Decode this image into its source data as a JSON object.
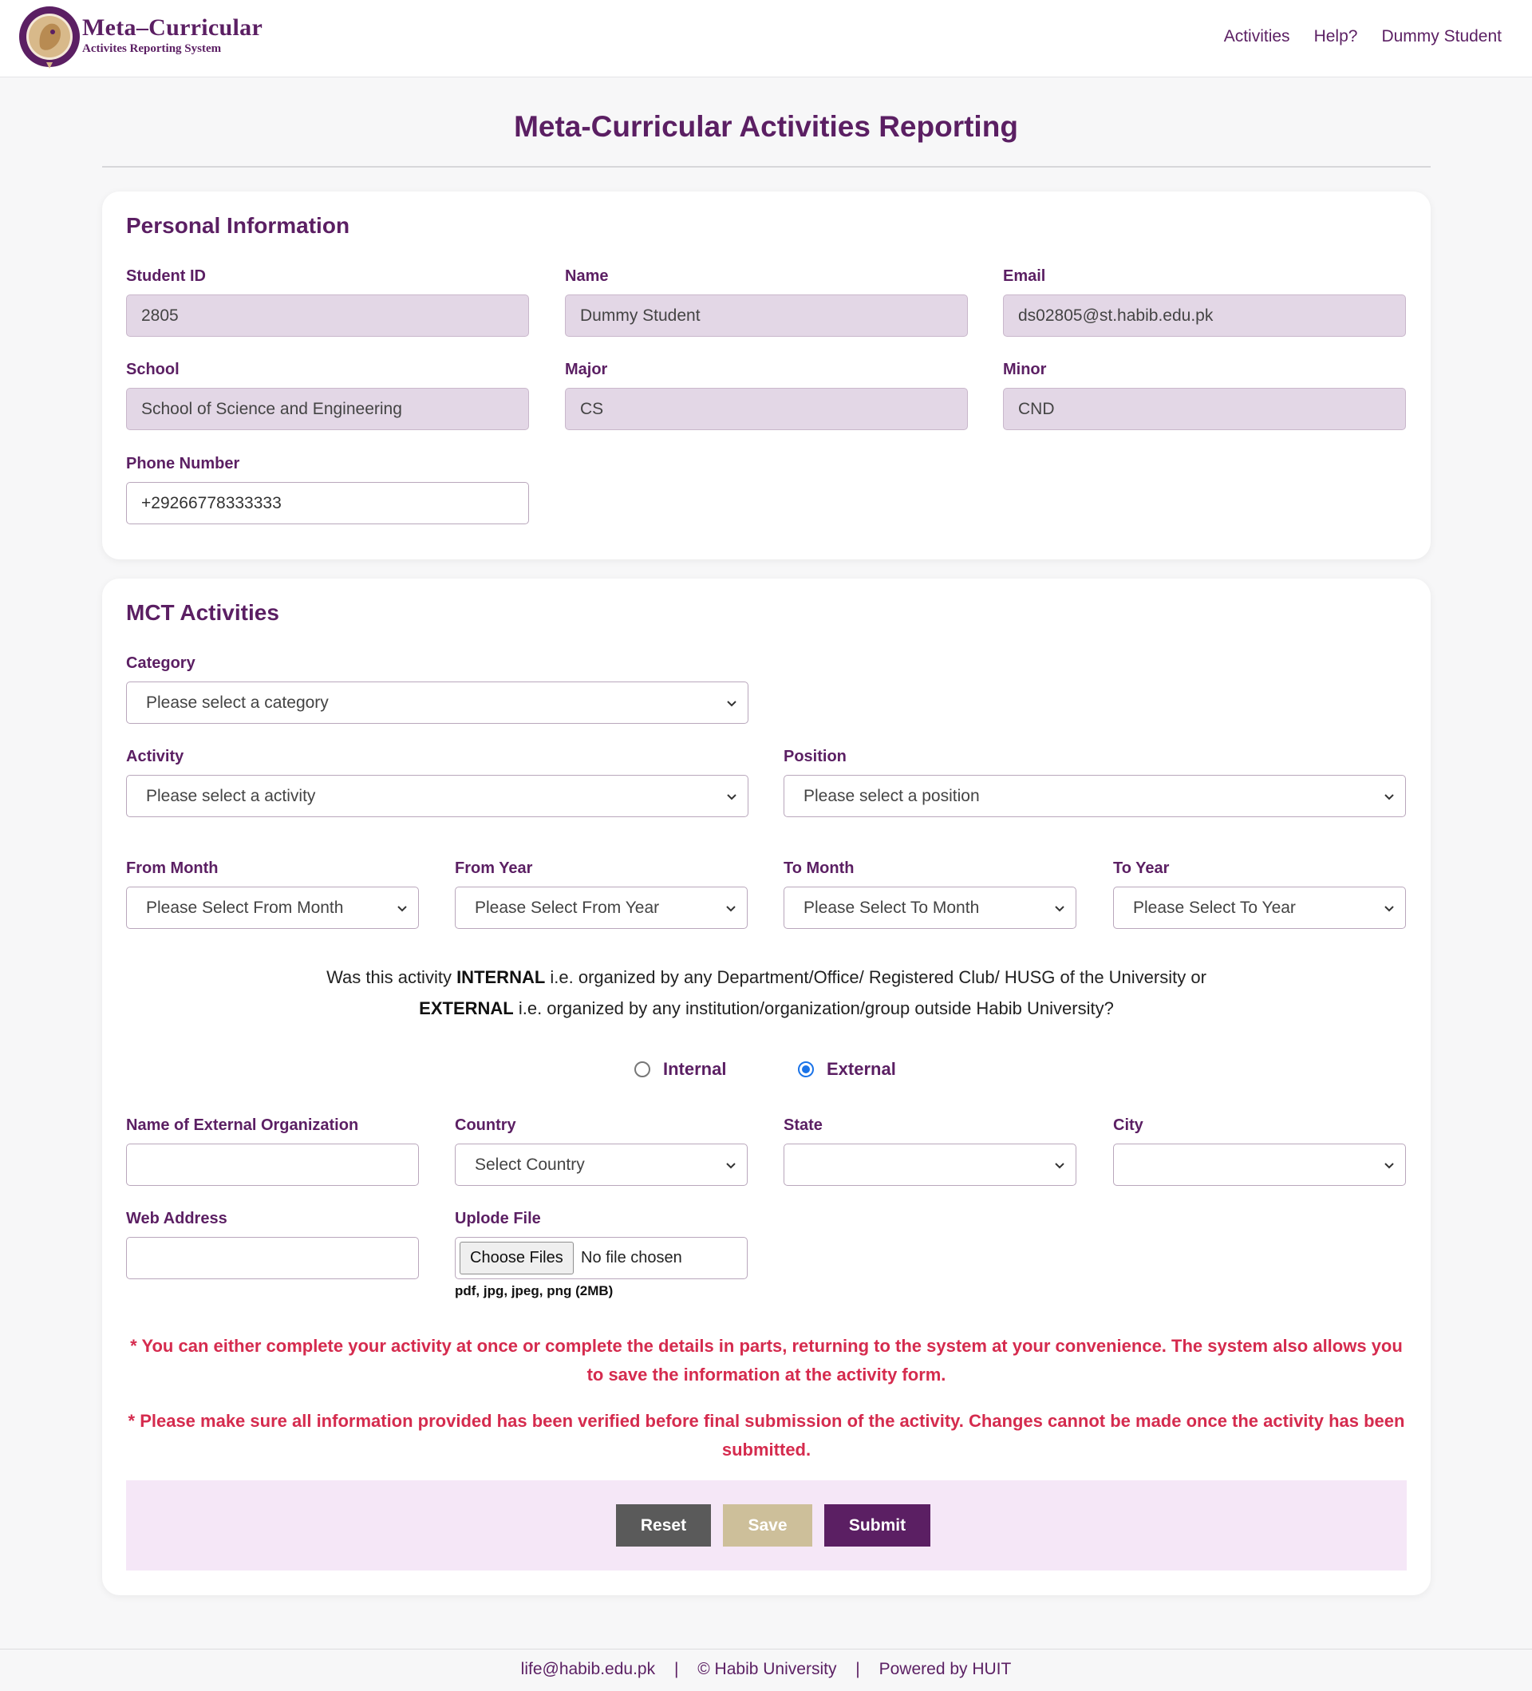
{
  "header": {
    "brand_title": "Meta–Curricular",
    "brand_subtitle": "Activites Reporting System",
    "seal_text": "HABIB UNIVERSITY",
    "nav": [
      "Activities",
      "Help?",
      "Dummy Student"
    ]
  },
  "page": {
    "title": "Meta-Curricular Activities Reporting"
  },
  "personal": {
    "section_title": "Personal Information",
    "student_id": {
      "label": "Student ID",
      "value": "2805"
    },
    "name": {
      "label": "Name",
      "value": "Dummy Student"
    },
    "email": {
      "label": "Email",
      "value": "ds02805@st.habib.edu.pk"
    },
    "school": {
      "label": "School",
      "value": "School of Science and Engineering"
    },
    "major": {
      "label": "Major",
      "value": "CS"
    },
    "minor": {
      "label": "Minor",
      "value": "CND"
    },
    "phone": {
      "label": "Phone Number",
      "value": "+29266778333333"
    }
  },
  "mct": {
    "section_title": "MCT Activities",
    "category": {
      "label": "Category",
      "value": "Please select a category"
    },
    "activity": {
      "label": "Activity",
      "value": "Please select a activity"
    },
    "position": {
      "label": "Position",
      "value": "Please select a position"
    },
    "from_month": {
      "label": "From Month",
      "value": "Please Select From Month"
    },
    "from_year": {
      "label": "From Year",
      "value": "Please Select From Year"
    },
    "to_month": {
      "label": "To Month",
      "value": "Please Select To Month"
    },
    "to_year": {
      "label": "To Year",
      "value": "Please Select To Year"
    },
    "question": {
      "l1_pre": "Was this activity ",
      "l1_bold": "INTERNAL",
      "l1_post": " i.e. organized by any Department/Office/ Registered Club/ HUSG of the University or",
      "l2_bold": "EXTERNAL",
      "l2_post": " i.e. organized by any institution/organization/group outside Habib University?"
    },
    "radio_internal": "Internal",
    "radio_external": "External",
    "selected_option": "External",
    "ext_org": {
      "label": "Name of External Organization",
      "value": ""
    },
    "country": {
      "label": "Country",
      "value": "Select Country"
    },
    "state": {
      "label": "State",
      "value": ""
    },
    "city": {
      "label": "City",
      "value": ""
    },
    "web": {
      "label": "Web Address",
      "value": ""
    },
    "upload": {
      "label": "Uplode File",
      "button": "Choose Files",
      "status": "No file chosen",
      "hint": "pdf, jpg, jpeg, png (2MB)"
    },
    "notice_1": "* You can either complete your activity at once or complete the details in parts, returning to the system at your convenience. The system also allows you to save the information at the activity form.",
    "notice_2": "* Please make sure all information provided has been verified before final submission of the activity. Changes cannot be made once the activity has been submitted.",
    "buttons": {
      "reset": "Reset",
      "save": "Save",
      "submit": "Submit"
    }
  },
  "footer": {
    "email": "life@habib.edu.pk",
    "copyright": "© Habib University",
    "powered": "Powered by HUIT",
    "separator": "|"
  },
  "colors": {
    "brand": "#5b1f63",
    "readonly_bg": "#e3d7e6",
    "notice": "#d52b4e",
    "action_bar": "#f5e7f7",
    "reset": "#5a5a5a",
    "save": "#cdbf9a",
    "radio_accent": "#1a73e8"
  },
  "icons": [
    "university-seal-icon",
    "chevron-down-icon",
    "radio-icon"
  ]
}
